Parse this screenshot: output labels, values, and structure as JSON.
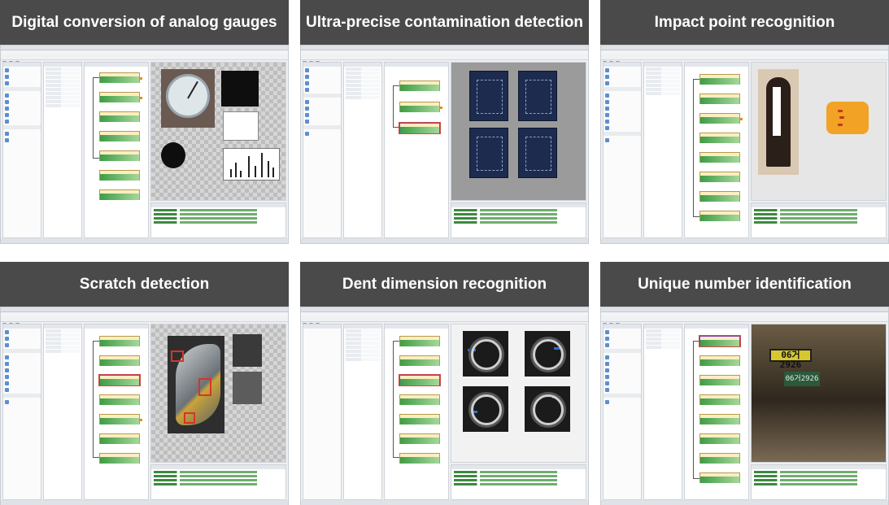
{
  "panels": [
    {
      "title": "Digital conversion of analog gauges"
    },
    {
      "title": "Ultra-precise contamination detection"
    },
    {
      "title": "Impact point recognition"
    },
    {
      "title": "Scratch detection"
    },
    {
      "title": "Dent dimension recognition"
    },
    {
      "title": "Unique number identification"
    }
  ],
  "license_plate": {
    "main": "06거2926",
    "secondary": "06거2926"
  }
}
